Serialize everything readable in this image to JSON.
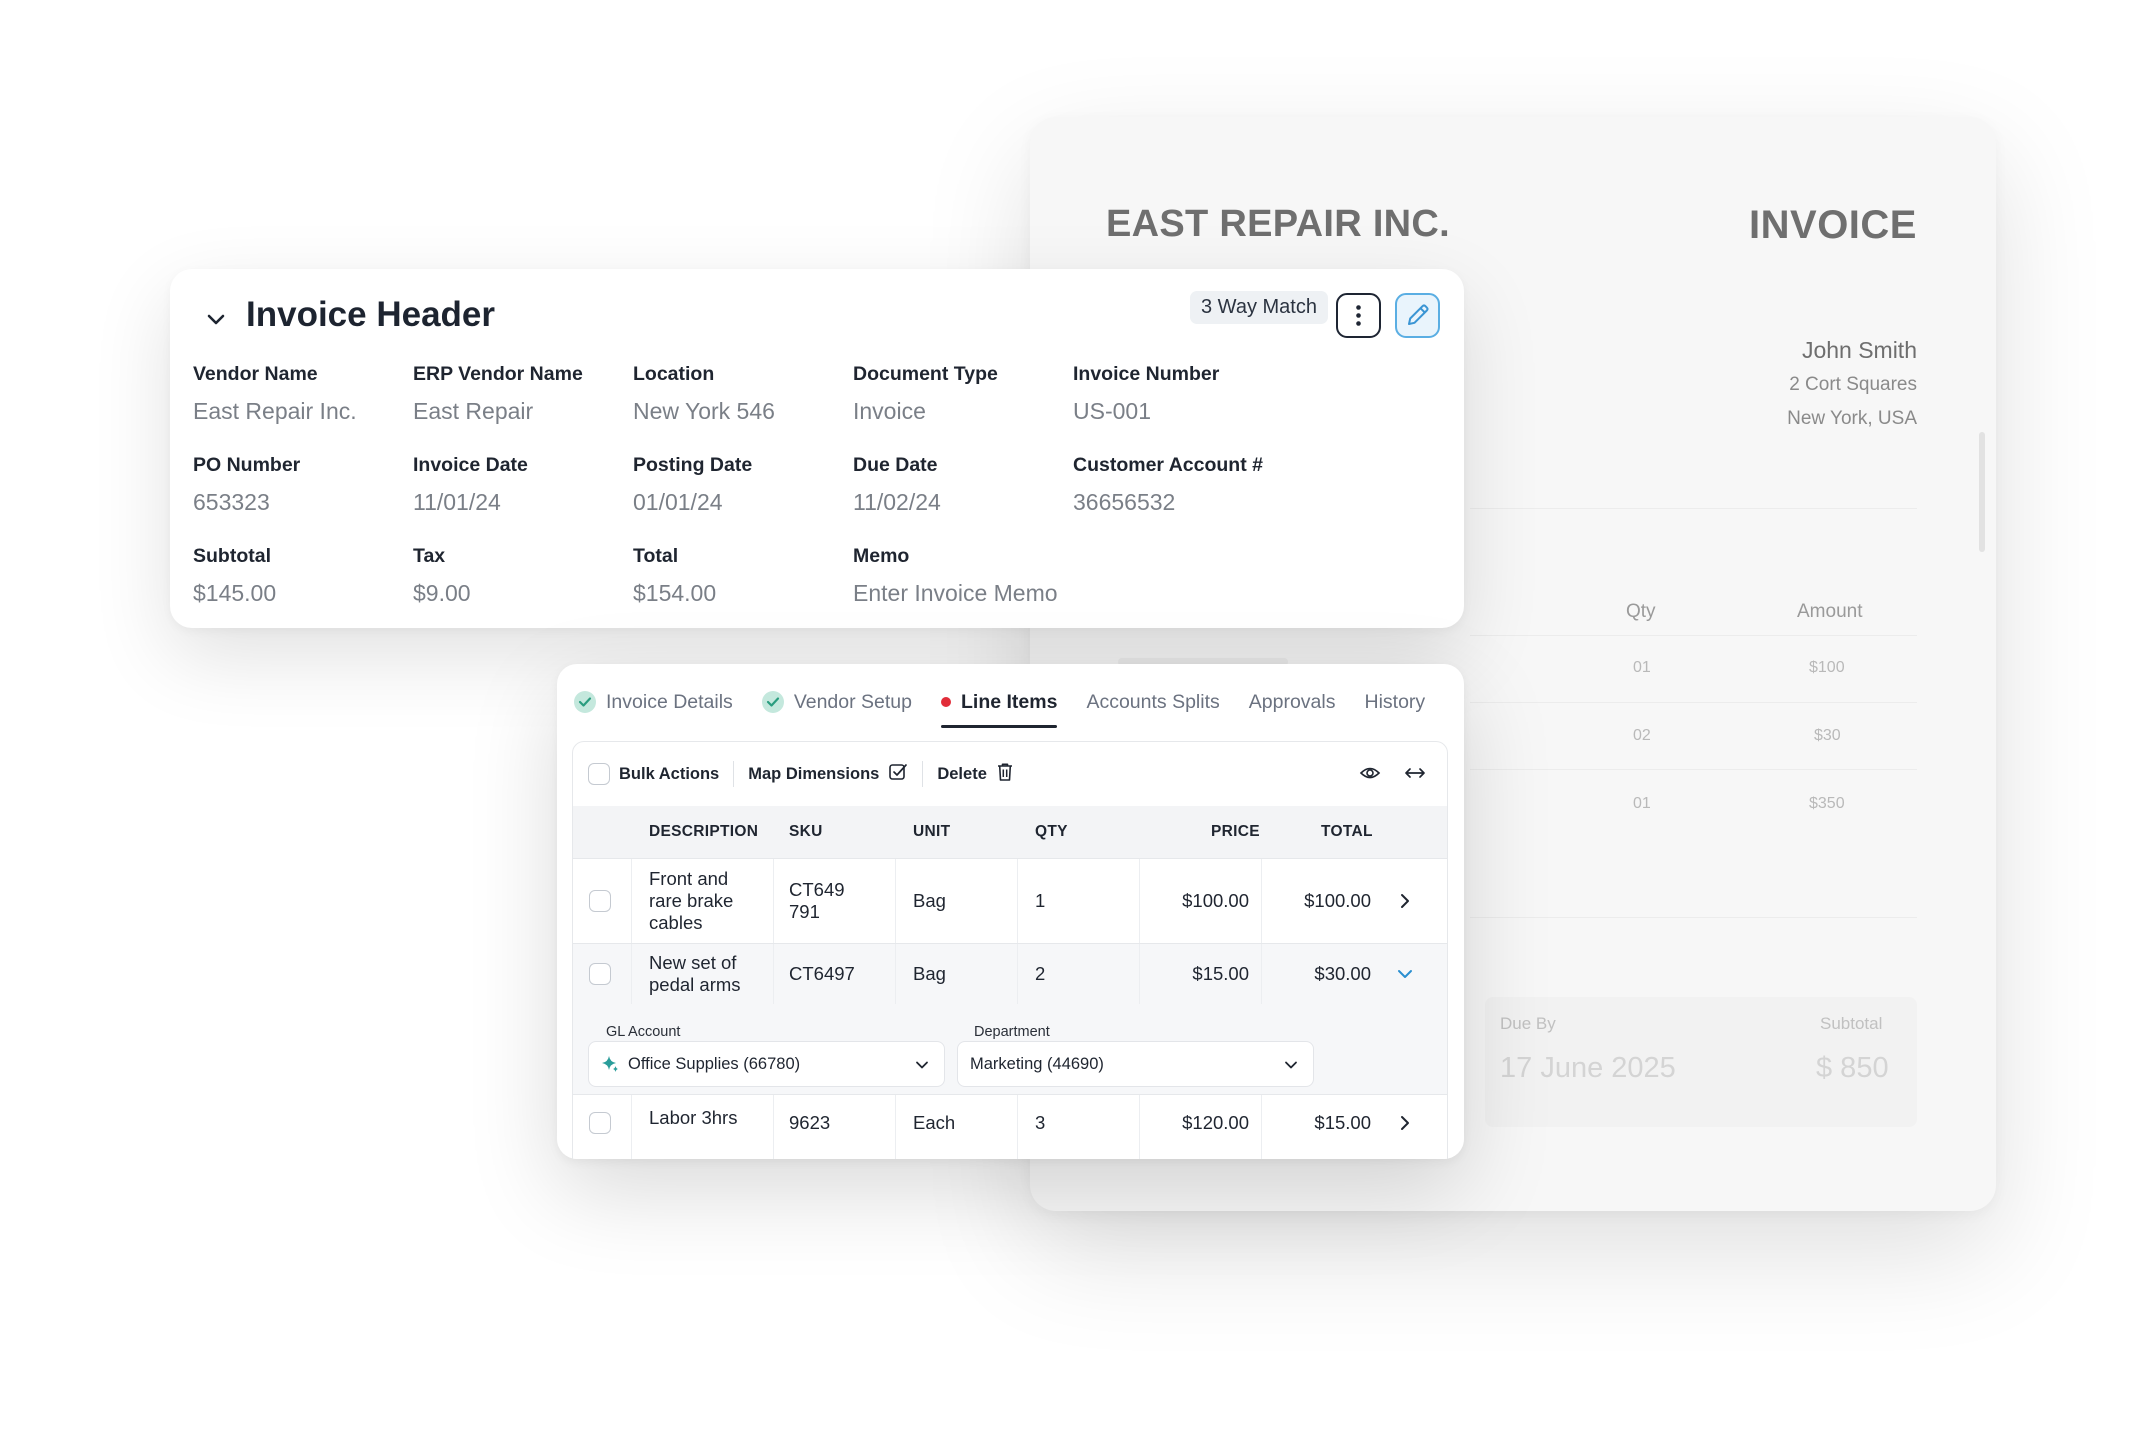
{
  "invoice_document": {
    "company": "EAST REPAIR INC.",
    "doc_title": "INVOICE",
    "customer_name": "John Smith",
    "customer_address_1": "2 Cort Squares",
    "customer_address_2": "New York, USA",
    "columns": {
      "qty": "Qty",
      "amount": "Amount"
    },
    "rows": [
      {
        "qty": "01",
        "amount": "$100"
      },
      {
        "qty": "02",
        "amount": "$30"
      },
      {
        "qty": "01",
        "amount": "$350"
      }
    ],
    "due_by_label": "Due By",
    "due_by_value": "17 June 2025",
    "subtotal_label": "Subtotal",
    "subtotal_value": "$ 850"
  },
  "invoice_header": {
    "title": "Invoice Header",
    "badge": "3 Way Match",
    "fields": {
      "vendor_name": {
        "label": "Vendor Name",
        "value": "East Repair Inc."
      },
      "erp_vendor_name": {
        "label": "ERP Vendor Name",
        "value": "East Repair"
      },
      "location": {
        "label": "Location",
        "value": "New York 546"
      },
      "document_type": {
        "label": "Document Type",
        "value": "Invoice"
      },
      "invoice_number": {
        "label": "Invoice Number",
        "value": "US-001"
      },
      "po_number": {
        "label": "PO Number",
        "value": "653323"
      },
      "invoice_date": {
        "label": "Invoice Date",
        "value": "11/01/24"
      },
      "posting_date": {
        "label": "Posting Date",
        "value": "01/01/24"
      },
      "due_date": {
        "label": "Due Date",
        "value": "11/02/24"
      },
      "customer_account": {
        "label": "Customer Account #",
        "value": "36656532"
      },
      "subtotal": {
        "label": "Subtotal",
        "value": "$145.00"
      },
      "tax": {
        "label": "Tax",
        "value": "$9.00"
      },
      "total": {
        "label": "Total",
        "value": "$154.00"
      },
      "memo": {
        "label": "Memo",
        "placeholder": "Enter Invoice Memo"
      }
    }
  },
  "tabs": [
    {
      "label": "Invoice Details",
      "status": "complete"
    },
    {
      "label": "Vendor Setup",
      "status": "complete"
    },
    {
      "label": "Line Items",
      "status": "error",
      "active": true
    },
    {
      "label": "Accounts Splits"
    },
    {
      "label": "Approvals"
    },
    {
      "label": "History"
    }
  ],
  "toolbar": {
    "bulk_actions": "Bulk Actions",
    "map_dimensions": "Map Dimensions",
    "delete": "Delete"
  },
  "table": {
    "headers": {
      "description": "DESCRIPTION",
      "sku": "SKU",
      "unit": "UNIT",
      "qty": "QTY",
      "price": "PRICE",
      "total": "TOTAL"
    },
    "rows": [
      {
        "description": "Front and rare brake cables",
        "sku": "CT649 791",
        "unit": "Bag",
        "qty": "1",
        "price": "$100.00",
        "total": "$100.00"
      },
      {
        "description": "New set of pedal arms",
        "sku": "CT6497",
        "unit": "Bag",
        "qty": "2",
        "price": "$15.00",
        "total": "$30.00"
      },
      {
        "description": "Labor 3hrs",
        "sku": "9623",
        "unit": "Each",
        "qty": "3",
        "price": "$120.00",
        "total": "$15.00"
      }
    ]
  },
  "row_detail": {
    "gl_account_label": "GL Account",
    "gl_account_value": "Office Supplies (66780)",
    "department_label": "Department",
    "department_value": "Marketing (44690)"
  },
  "colors": {
    "accent_blue": "#5aaee3",
    "success_green": "#2a9d7f",
    "error_red": "#e12d39",
    "text_dark": "#1f2530"
  }
}
